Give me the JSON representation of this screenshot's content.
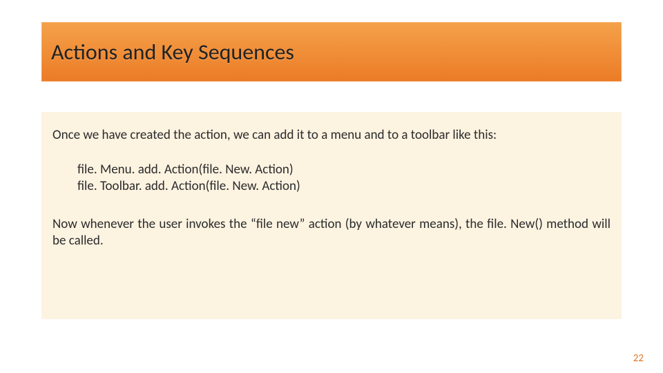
{
  "title": "Actions and Key Sequences",
  "intro": "Once we have created the action, we can add it to a menu and to a toolbar like this:",
  "code": {
    "line1": "file. Menu. add. Action(file. New. Action)",
    "line2": "file. Toolbar. add. Action(file. New. Action)"
  },
  "followup": "Now whenever the user invokes the “file new” action (by whatever means), the file. New() method will be called.",
  "page_number": "22"
}
